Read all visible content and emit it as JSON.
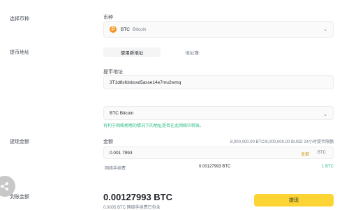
{
  "labels": {
    "select_coin": "选择币种",
    "withdraw_address": "提币地址",
    "withdraw_amount": "提现金额",
    "receive_amount": "到账金额"
  },
  "coin": {
    "section_title": "币种",
    "symbol": "BTC",
    "name": "Bitcoin"
  },
  "address": {
    "tabs": [
      "使用新地址",
      "地址簿"
    ],
    "field_label": "提币地址",
    "value": "3T1d8sfdsbsxd5asse14e7mu2wmq",
    "network_value": "BTC  Bitcoin",
    "network_note": "有利于网络拥堵的情况下的地址是否在此网络中转账。"
  },
  "amount": {
    "label": "金额",
    "limit_text": "8,000,000.00 BTC/8,000,000.00 BUSD  24小时提币限额",
    "value": "0.001 7993",
    "max_label": "全部",
    "unit": "BTC",
    "fee_label": "网络手续费",
    "fee_value": "0.00127993 BTC",
    "fee_right": "1 BTC"
  },
  "receive": {
    "amount": "0.00127993 BTC",
    "sub": "0.0005 BTC 网络手续费已包含",
    "button_label": "提现"
  },
  "colors": {
    "accent": "#fcd535",
    "btc": "#f7931a",
    "positive": "#2ebd85"
  }
}
